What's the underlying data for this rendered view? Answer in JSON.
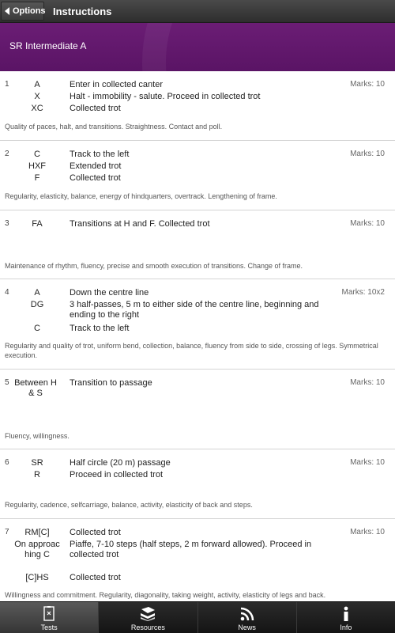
{
  "actionbar": {
    "back_label": "Options",
    "title": "Instructions"
  },
  "header": {
    "title": "SR Intermediate A"
  },
  "movements": [
    {
      "number": "1",
      "marks": "Marks: 10",
      "lines": [
        {
          "letter": "A",
          "text": "Enter in collected canter"
        },
        {
          "letter": "X",
          "text": "Halt - immobility - salute. Proceed in collected trot"
        },
        {
          "letter": "XC",
          "text": "Collected trot"
        }
      ],
      "comment": "Quality of paces, halt, and transitions. Straightness. Contact and poll."
    },
    {
      "number": "2",
      "marks": "Marks: 10",
      "lines": [
        {
          "letter": "C",
          "text": "Track to the left"
        },
        {
          "letter": "HXF",
          "text": "Extended trot"
        },
        {
          "letter": "F",
          "text": "Collected trot"
        }
      ],
      "comment": "Regularity, elasticity, balance, energy of hindquarters, overtrack. Lengthening of frame."
    },
    {
      "number": "3",
      "marks": "Marks: 10",
      "lines": [
        {
          "letter": "FA",
          "text": "Transitions at H and F. Collected trot"
        }
      ],
      "comment": "Maintenance of rhythm, fluency, precise and smooth execution of transitions. Change of frame."
    },
    {
      "number": "4",
      "marks": "Marks: 10x2",
      "lines": [
        {
          "letter": "A",
          "text": "Down the centre line"
        },
        {
          "letter": "DG",
          "text": "3 half-passes, 5 m to either side of the centre line, beginning and ending to the right"
        },
        {
          "letter": "C",
          "text": "Track to the left"
        }
      ],
      "comment": "Regularity and quality of trot, uniform bend, collection, balance, fluency from side to side, crossing of legs. Symmetrical execution."
    },
    {
      "number": "5",
      "marks": "Marks: 10",
      "lines": [
        {
          "letter": "Between H & S",
          "text": "Transition to passage"
        }
      ],
      "comment": "Fluency, willingness."
    },
    {
      "number": "6",
      "marks": "Marks: 10",
      "lines": [
        {
          "letter": "SR",
          "text": "Half circle (20 m) passage"
        },
        {
          "letter": "R",
          "text": "Proceed in collected trot"
        }
      ],
      "comment": "Regularity, cadence, selfcarriage, balance, activity, elasticity of back and steps."
    },
    {
      "number": "7",
      "marks": "Marks: 10",
      "lines": [
        {
          "letter": "RM[C]",
          "text": "Collected trot"
        },
        {
          "letter": "On approaching C",
          "text": "Piaffe, 7-10 steps (half steps, 2 m forward allowed). Proceed in collected trot"
        },
        {
          "letter": "[C]HS",
          "text": "Collected trot"
        }
      ],
      "comment": "Willingness and commitment. Regularity, diagonality, taking weight, activity, elasticity of legs and back."
    }
  ],
  "tabs": [
    {
      "label": "Tests",
      "icon": "tests-icon",
      "active": true
    },
    {
      "label": "Resources",
      "icon": "books-icon",
      "active": false
    },
    {
      "label": "News",
      "icon": "rss-icon",
      "active": false
    },
    {
      "label": "Info",
      "icon": "info-icon",
      "active": false
    }
  ]
}
